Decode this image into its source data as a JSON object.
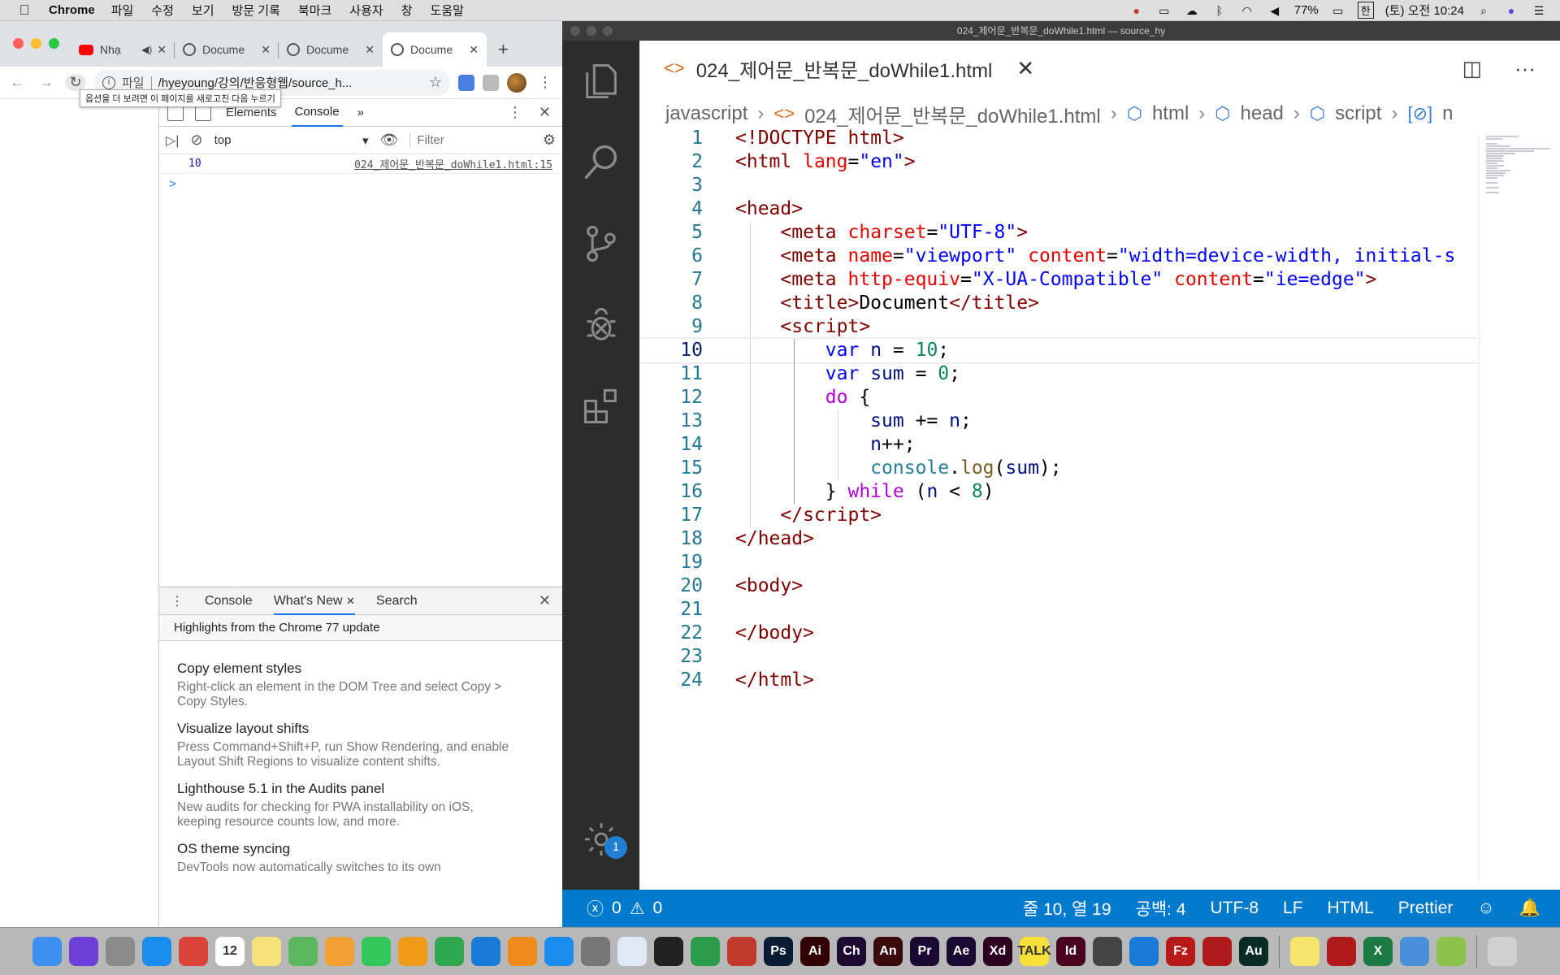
{
  "menubar": {
    "apple": "",
    "app": "Chrome",
    "menus": [
      "파일",
      "수정",
      "보기",
      "방문 기록",
      "북마크",
      "사용자",
      "창",
      "도움말"
    ],
    "battery": "77%",
    "input_method": "한",
    "clock": "(토) 오전 10:24"
  },
  "chrome": {
    "tabs": [
      {
        "title": "Nhạ",
        "favicon": "youtube-icon"
      },
      {
        "title": "Docume",
        "favicon": "globe-icon"
      },
      {
        "title": "Docume",
        "favicon": "globe-icon"
      },
      {
        "title": "Docume",
        "favicon": "globe-icon"
      }
    ],
    "address": {
      "scheme": "파일",
      "url": "/hyeyoung/강의/반응형웹/source_h..."
    },
    "tooltip": "옵션을 더 보려면 이 페이지를 새로고친 다음 누르기"
  },
  "devtools": {
    "tabs": [
      "Elements",
      "Console"
    ],
    "more": "»",
    "context": "top",
    "filter": "Filter",
    "console_rows": [
      {
        "value": "10",
        "source": "024_제어문_반복문_doWhile1.html:15"
      }
    ],
    "prompt": ">",
    "drawer": {
      "tabs": [
        "Console",
        "What's New",
        "Search"
      ],
      "header": "Highlights from the Chrome 77 update",
      "features": [
        {
          "title": "Copy element styles",
          "desc": "Right-click an element in the DOM Tree and select Copy > Copy Styles."
        },
        {
          "title": "Visualize layout shifts",
          "desc": "Press Command+Shift+P, run Show Rendering, and enable Layout Shift Regions to visualize content shifts."
        },
        {
          "title": "Lighthouse 5.1 in the Audits panel",
          "desc": "New audits for checking for PWA installability on iOS, keeping resource counts low, and more."
        },
        {
          "title": "OS theme syncing",
          "desc": "DevTools now automatically switches to its own"
        }
      ]
    }
  },
  "vscode": {
    "window_title": "024_제어문_반복문_doWhile1.html — source_hy",
    "tab_title": "024_제어문_반복문_doWhile1.html",
    "breadcrumb": [
      "javascript",
      "024_제어문_반복문_doWhile1.html",
      "html",
      "head",
      "script",
      "n"
    ],
    "settings_badge": "1",
    "code": [
      {
        "n": "1",
        "html": "<span class='t-tag'>&lt;!DOCTYPE html&gt;</span>"
      },
      {
        "n": "2",
        "html": "<span class='t-tag'>&lt;html</span> <span class='t-attr'>lang</span>=<span class='t-str'>\"en\"</span><span class='t-tag'>&gt;</span>"
      },
      {
        "n": "3",
        "html": ""
      },
      {
        "n": "4",
        "html": "<span class='t-tag'>&lt;head&gt;</span>"
      },
      {
        "n": "5",
        "html": "    <span class='t-tag'>&lt;meta</span> <span class='t-attr'>charset</span>=<span class='t-str'>\"UTF-8\"</span><span class='t-tag'>&gt;</span>"
      },
      {
        "n": "6",
        "html": "    <span class='t-tag'>&lt;meta</span> <span class='t-attr'>name</span>=<span class='t-str'>\"viewport\"</span> <span class='t-attr'>content</span>=<span class='t-str'>\"width=device-width, initial-s</span>"
      },
      {
        "n": "7",
        "html": "    <span class='t-tag'>&lt;meta</span> <span class='t-attr'>http-equiv</span>=<span class='t-str'>\"X-UA-Compatible\"</span> <span class='t-attr'>content</span>=<span class='t-str'>\"ie=edge\"</span><span class='t-tag'>&gt;</span>"
      },
      {
        "n": "8",
        "html": "    <span class='t-tag'>&lt;title&gt;</span>Document<span class='t-tag'>&lt;/title&gt;</span>"
      },
      {
        "n": "9",
        "html": "    <span class='t-tag'>&lt;script&gt;</span>"
      },
      {
        "n": "10",
        "html": "        <span class='t-kw'>var</span> <span class='t-var'>n</span> = <span class='t-num'>10</span>;",
        "current": true
      },
      {
        "n": "11",
        "html": "        <span class='t-kw'>var</span> <span class='t-var'>sum</span> = <span class='t-num'>0</span>;"
      },
      {
        "n": "12",
        "html": "        <span class='t-ctrl'>do</span> {"
      },
      {
        "n": "13",
        "html": "            <span class='t-var'>sum</span> += <span class='t-var'>n</span>;"
      },
      {
        "n": "14",
        "html": "            <span class='t-var'>n</span>++;"
      },
      {
        "n": "15",
        "html": "            <span class='t-obj'>console</span>.<span class='t-fn'>log</span>(<span class='t-var'>sum</span>);"
      },
      {
        "n": "16",
        "html": "        } <span class='t-ctrl'>while</span> (<span class='t-var'>n</span> &lt; <span class='t-num'>8</span>)"
      },
      {
        "n": "17",
        "html": "    <span class='t-tag'>&lt;/script&gt;</span>"
      },
      {
        "n": "18",
        "html": "<span class='t-tag'>&lt;/head&gt;</span>"
      },
      {
        "n": "19",
        "html": ""
      },
      {
        "n": "20",
        "html": "<span class='t-tag'>&lt;body&gt;</span>"
      },
      {
        "n": "21",
        "html": ""
      },
      {
        "n": "22",
        "html": "<span class='t-tag'>&lt;/body&gt;</span>"
      },
      {
        "n": "23",
        "html": ""
      },
      {
        "n": "24",
        "html": "<span class='t-tag'>&lt;/html&gt;</span>"
      }
    ],
    "status": {
      "errors": "0",
      "warnings": "0",
      "position": "줄 10, 열 19",
      "spaces": "공백: 4",
      "encoding": "UTF-8",
      "eol": "LF",
      "language": "HTML",
      "formatter": "Prettier"
    }
  },
  "dock": [
    {
      "name": "finder-icon",
      "label": "",
      "color": "#3d8ff0"
    },
    {
      "name": "siri-icon",
      "label": "",
      "color": "#6b3fd8"
    },
    {
      "name": "launchpad-icon",
      "label": "",
      "color": "#8a8a8a"
    },
    {
      "name": "safari-icon",
      "label": "",
      "color": "#1a8cf0"
    },
    {
      "name": "chrome-icon",
      "label": "",
      "color": "#db4437"
    },
    {
      "name": "calendar-icon",
      "label": "12",
      "color": "#ffffff"
    },
    {
      "name": "notes-icon",
      "label": "",
      "color": "#f7e27a"
    },
    {
      "name": "maps-icon",
      "label": "",
      "color": "#5cb85c"
    },
    {
      "name": "photos-icon",
      "label": "",
      "color": "#f0a030"
    },
    {
      "name": "facetime-icon",
      "label": "",
      "color": "#34c759"
    },
    {
      "name": "pages-icon",
      "label": "",
      "color": "#f09a1a"
    },
    {
      "name": "numbers-icon",
      "label": "",
      "color": "#2fa84f"
    },
    {
      "name": "keynote-icon",
      "label": "",
      "color": "#1a7ad8"
    },
    {
      "name": "books-icon",
      "label": "",
      "color": "#f08a1a"
    },
    {
      "name": "appstore-icon",
      "label": "",
      "color": "#1a8cf0"
    },
    {
      "name": "system-preferences-icon",
      "label": "",
      "color": "#777777"
    },
    {
      "name": "sourcetree-icon",
      "label": "",
      "color": "#dfe8f5"
    },
    {
      "name": "terminal-icon",
      "label": "",
      "color": "#222222"
    },
    {
      "name": "activity-icon",
      "label": "",
      "color": "#2a9d4a"
    },
    {
      "name": "photobooth-icon",
      "label": "",
      "color": "#c0392b"
    },
    {
      "name": "photoshop-icon",
      "label": "Ps",
      "color": "#0a1c33"
    },
    {
      "name": "illustrator-icon",
      "label": "Ai",
      "color": "#330000"
    },
    {
      "name": "character-animator-icon",
      "label": "Ch",
      "color": "#1d0a33"
    },
    {
      "name": "animate-icon",
      "label": "An",
      "color": "#3a0a0a"
    },
    {
      "name": "premiere-icon",
      "label": "Pr",
      "color": "#1a0a33"
    },
    {
      "name": "after-effects-icon",
      "label": "Ae",
      "color": "#1a0a33"
    },
    {
      "name": "xd-icon",
      "label": "Xd",
      "color": "#2e001f"
    },
    {
      "name": "kakaotalk-icon",
      "label": "TALK",
      "color": "#f7e03a"
    },
    {
      "name": "indesign-icon",
      "label": "Id",
      "color": "#49021f"
    },
    {
      "name": "quicktime-icon",
      "label": "",
      "color": "#444444"
    },
    {
      "name": "vscode-icon",
      "label": "",
      "color": "#1a7ad8"
    },
    {
      "name": "filezilla-icon",
      "label": "Fz",
      "color": "#b81a1a"
    },
    {
      "name": "mendeley-icon",
      "label": "",
      "color": "#b01a1a"
    },
    {
      "name": "audition-icon",
      "label": "Au",
      "color": "#0a2a28"
    },
    {
      "name": "stickies-icon",
      "label": "",
      "color": "#f5e56b"
    },
    {
      "name": "acrobat-icon",
      "label": "",
      "color": "#b01a1a"
    },
    {
      "name": "excel-icon",
      "label": "X",
      "color": "#1d7a43"
    },
    {
      "name": "file-icon",
      "label": "",
      "color": "#4a90d9"
    },
    {
      "name": "app-icon",
      "label": "",
      "color": "#8bc34a"
    },
    {
      "name": "trash-icon",
      "label": "",
      "color": "#d0d0d0"
    }
  ]
}
